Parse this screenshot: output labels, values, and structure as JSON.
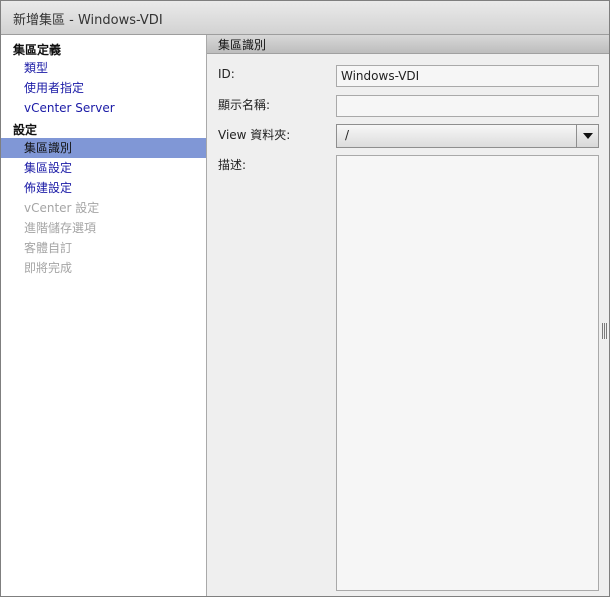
{
  "window": {
    "title": "新增集區 - Windows-VDI"
  },
  "sidebar": {
    "group1": {
      "header": "集區定義",
      "items": [
        {
          "label": "類型",
          "state": "link"
        },
        {
          "label": "使用者指定",
          "state": "link"
        },
        {
          "label": "vCenter Server",
          "state": "link"
        }
      ]
    },
    "group2": {
      "header": "設定",
      "items": [
        {
          "label": "集區識別",
          "state": "active"
        },
        {
          "label": "集區設定",
          "state": "link"
        },
        {
          "label": "佈建設定",
          "state": "link"
        },
        {
          "label": "vCenter 設定",
          "state": "disabled"
        },
        {
          "label": "進階儲存選項",
          "state": "disabled"
        },
        {
          "label": "客體自訂",
          "state": "disabled"
        },
        {
          "label": "即將完成",
          "state": "disabled"
        }
      ]
    }
  },
  "main": {
    "section_title": "集區識別",
    "fields": {
      "id": {
        "label": "ID:",
        "value": "Windows-VDI"
      },
      "display_name": {
        "label": "顯示名稱:",
        "value": ""
      },
      "view_folder": {
        "label": "View 資料夾:",
        "value": "/"
      },
      "description": {
        "label": "描述:",
        "value": ""
      }
    }
  },
  "colors": {
    "active_item_bg": "#8097d6",
    "link_text": "#1a1aa6",
    "disabled_text": "#a5a5a5"
  }
}
